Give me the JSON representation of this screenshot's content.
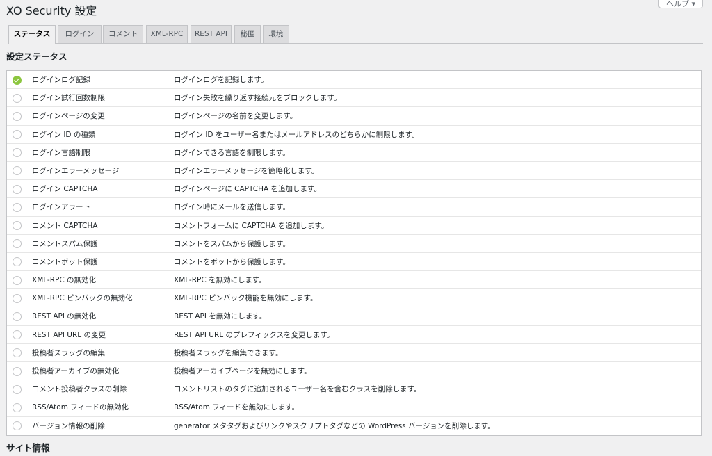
{
  "header": {
    "title": "XO Security 設定",
    "help_label": "ヘルプ ▾"
  },
  "tabs": [
    {
      "label": "ステータス",
      "active": true
    },
    {
      "label": "ログイン",
      "active": false
    },
    {
      "label": "コメント",
      "active": false
    },
    {
      "label": "XML-RPC",
      "active": false
    },
    {
      "label": "REST API",
      "active": false
    },
    {
      "label": "秘匿",
      "active": false
    },
    {
      "label": "環境",
      "active": false
    }
  ],
  "status_section": {
    "title": "設定ステータス",
    "rows": [
      {
        "name": "ログインログ記録",
        "description": "ログインログを記録します。",
        "enabled": true
      },
      {
        "name": "ログイン試行回数制限",
        "description": "ログイン失敗を繰り返す接続元をブロックします。",
        "enabled": false
      },
      {
        "name": "ログインページの変更",
        "description": "ログインページの名前を変更します。",
        "enabled": false
      },
      {
        "name": "ログイン ID の種類",
        "description": "ログイン ID をユーザー名またはメールアドレスのどちらかに制限します。",
        "enabled": false
      },
      {
        "name": "ログイン言語制限",
        "description": "ログインできる言語を制限します。",
        "enabled": false
      },
      {
        "name": "ログインエラーメッセージ",
        "description": "ログインエラーメッセージを簡略化します。",
        "enabled": false
      },
      {
        "name": "ログイン CAPTCHA",
        "description": "ログインページに CAPTCHA を追加します。",
        "enabled": false
      },
      {
        "name": "ログインアラート",
        "description": "ログイン時にメールを送信します。",
        "enabled": false
      },
      {
        "name": "コメント CAPTCHA",
        "description": "コメントフォームに CAPTCHA を追加します。",
        "enabled": false
      },
      {
        "name": "コメントスパム保護",
        "description": "コメントをスパムから保護します。",
        "enabled": false
      },
      {
        "name": "コメントボット保護",
        "description": "コメントをボットから保護します。",
        "enabled": false
      },
      {
        "name": "XML-RPC の無効化",
        "description": "XML-RPC を無効にします。",
        "enabled": false
      },
      {
        "name": "XML-RPC ピンバックの無効化",
        "description": "XML-RPC ピンバック機能を無効にします。",
        "enabled": false
      },
      {
        "name": "REST API の無効化",
        "description": "REST API を無効にします。",
        "enabled": false
      },
      {
        "name": "REST API URL の変更",
        "description": "REST API URL のプレフィックスを変更します。",
        "enabled": false
      },
      {
        "name": "投稿者スラッグの編集",
        "description": "投稿者スラッグを編集できます。",
        "enabled": false
      },
      {
        "name": "投稿者アーカイブの無効化",
        "description": "投稿者アーカイブページを無効にします。",
        "enabled": false
      },
      {
        "name": "コメント投稿者クラスの削除",
        "description": "コメントリストのタグに追加されるユーザー名を含むクラスを削除します。",
        "enabled": false
      },
      {
        "name": "RSS/Atom フィードの無効化",
        "description": "RSS/Atom フィードを無効にします。",
        "enabled": false
      },
      {
        "name": "バージョン情報の削除",
        "description": "generator メタタグおよびリンクやスクリプトタグなどの WordPress バージョンを削除します。",
        "enabled": false
      }
    ]
  },
  "site_section": {
    "title": "サイト情報"
  },
  "colors": {
    "enabled": "#8cc63f",
    "disabled_border": "#c3c4c7",
    "background": "#f0f0f1"
  },
  "icons": {
    "enabled": "check-circle-icon",
    "disabled": "empty-circle-icon"
  }
}
